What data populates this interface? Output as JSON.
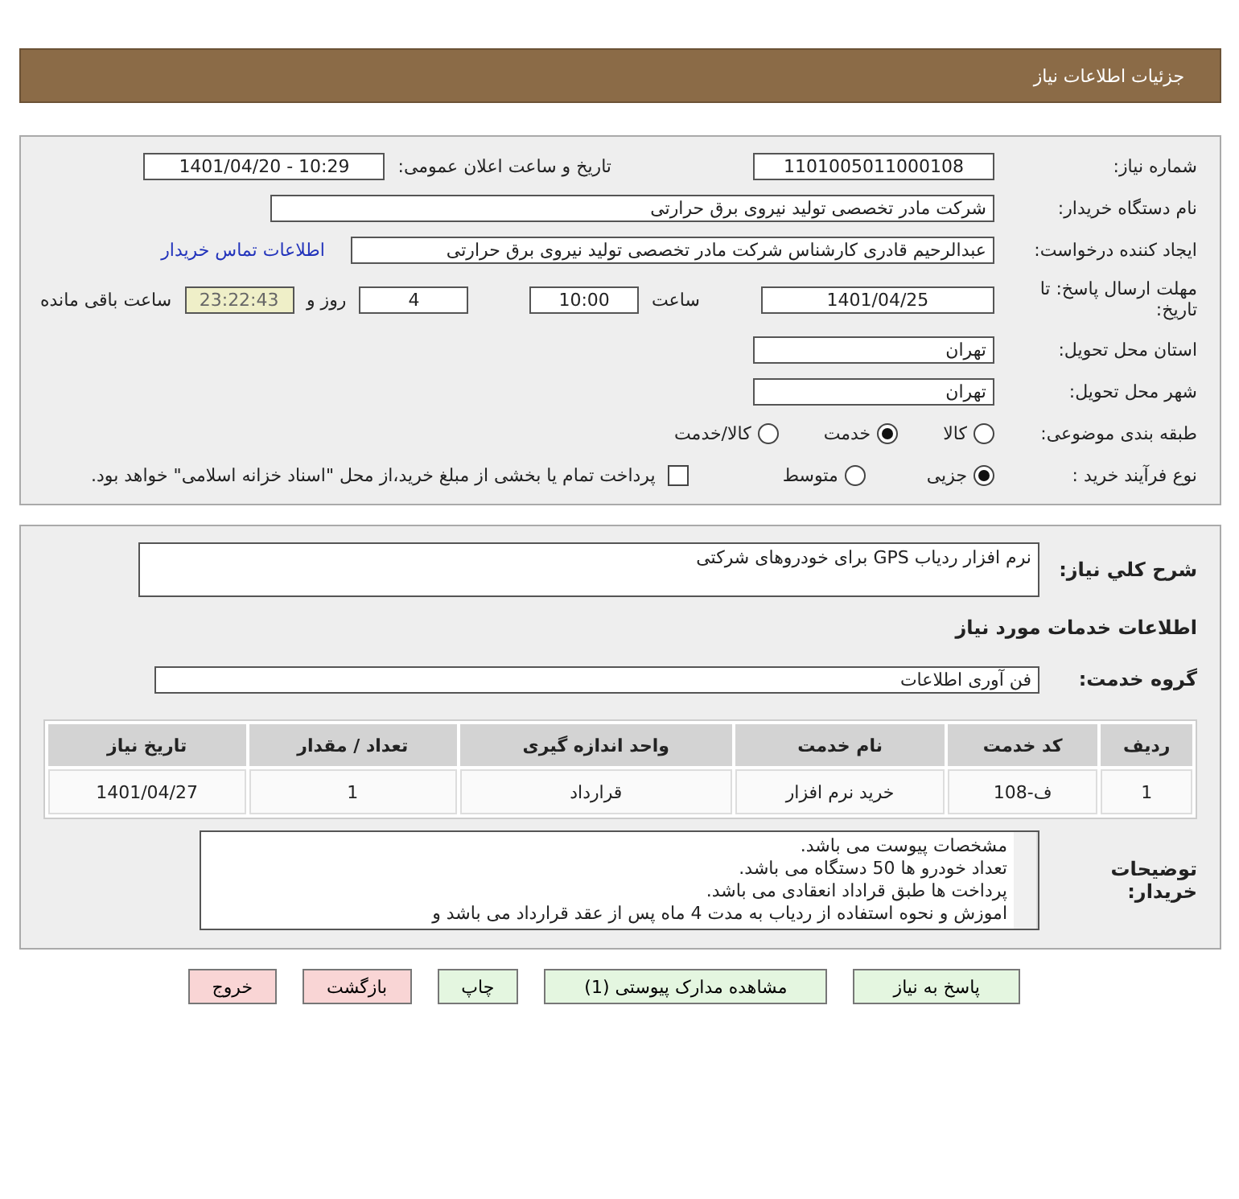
{
  "header": {
    "title": "جزئیات اطلاعات نیاز"
  },
  "need_info": {
    "need_number_label": "شماره نیاز:",
    "need_number": "1101005011000108",
    "announce_label": "تاریخ و ساعت اعلان عمومی:",
    "announce_value": "1401/04/20 - 10:29",
    "buyer_label": "نام دستگاه خریدار:",
    "buyer": "شرکت مادر تخصصی تولید نیروی برق حرارتی",
    "creator_label": "ایجاد کننده درخواست:",
    "creator": "عبدالرحیم قادری کارشناس شرکت مادر تخصصی تولید نیروی برق حرارتی",
    "contact_link": "اطلاعات تماس خریدار",
    "deadline_label": "مهلت ارسال پاسخ: تا تاریخ:",
    "deadline_date": "1401/04/25",
    "time_label": "ساعت",
    "deadline_time": "10:00",
    "days": "4",
    "days_label": "روز و",
    "remaining": "23:22:43",
    "remaining_label": "ساعت باقی مانده",
    "province_label": "استان محل تحویل:",
    "province": "تهران",
    "city_label": "شهر محل تحویل:",
    "city": "تهران",
    "category_label": "طبقه بندی موضوعی:",
    "categories": [
      {
        "label": "کالا",
        "selected": false
      },
      {
        "label": "خدمت",
        "selected": true
      },
      {
        "label": "کالا/خدمت",
        "selected": false
      }
    ],
    "process_label": "نوع فرآیند خرید :",
    "processes": [
      {
        "label": "جزیی",
        "selected": true
      },
      {
        "label": "متوسط",
        "selected": false
      }
    ],
    "treasury": {
      "label": "پرداخت تمام یا بخشی از مبلغ خرید،از محل \"اسناد خزانه اسلامی\" خواهد بود.",
      "checked": false
    }
  },
  "details": {
    "summary_label": "شرح کلي نیاز:",
    "summary": "نرم افزار ردیاب GPS برای خودروهای شرکتی",
    "services_heading": "اطلاعات خدمات مورد نیاز",
    "group_label": "گروه خدمت:",
    "group": "فن آوری اطلاعات",
    "table": {
      "columns": [
        "ردیف",
        "کد خدمت",
        "نام خدمت",
        "واحد اندازه گیری",
        "تعداد / مقدار",
        "تاریخ نیاز"
      ],
      "rows": [
        [
          "1",
          "ف-108",
          "خرید نرم افزار",
          "قرارداد",
          "1",
          "1401/04/27"
        ]
      ]
    },
    "notes_label": "توضیحات خریدار:",
    "notes": [
      "مشخصات پیوست می باشد.",
      "تعداد خودرو ها 50 دستگاه می باشد.",
      "پرداخت ها طبق قراداد انعقادی می باشد.",
      "اموزش و نحوه استفاده از ردیاب به مدت 4 ماه پس از عقد قرارداد می باشد و"
    ]
  },
  "buttons": [
    {
      "label": "پاسخ به نیاز",
      "kind": "normal"
    },
    {
      "label": "مشاهده مدارک پیوستی (1)",
      "kind": "normal"
    },
    {
      "label": "چاپ",
      "kind": "normal"
    },
    {
      "label": "بازگشت",
      "kind": "danger"
    },
    {
      "label": "خروج",
      "kind": "danger"
    }
  ]
}
